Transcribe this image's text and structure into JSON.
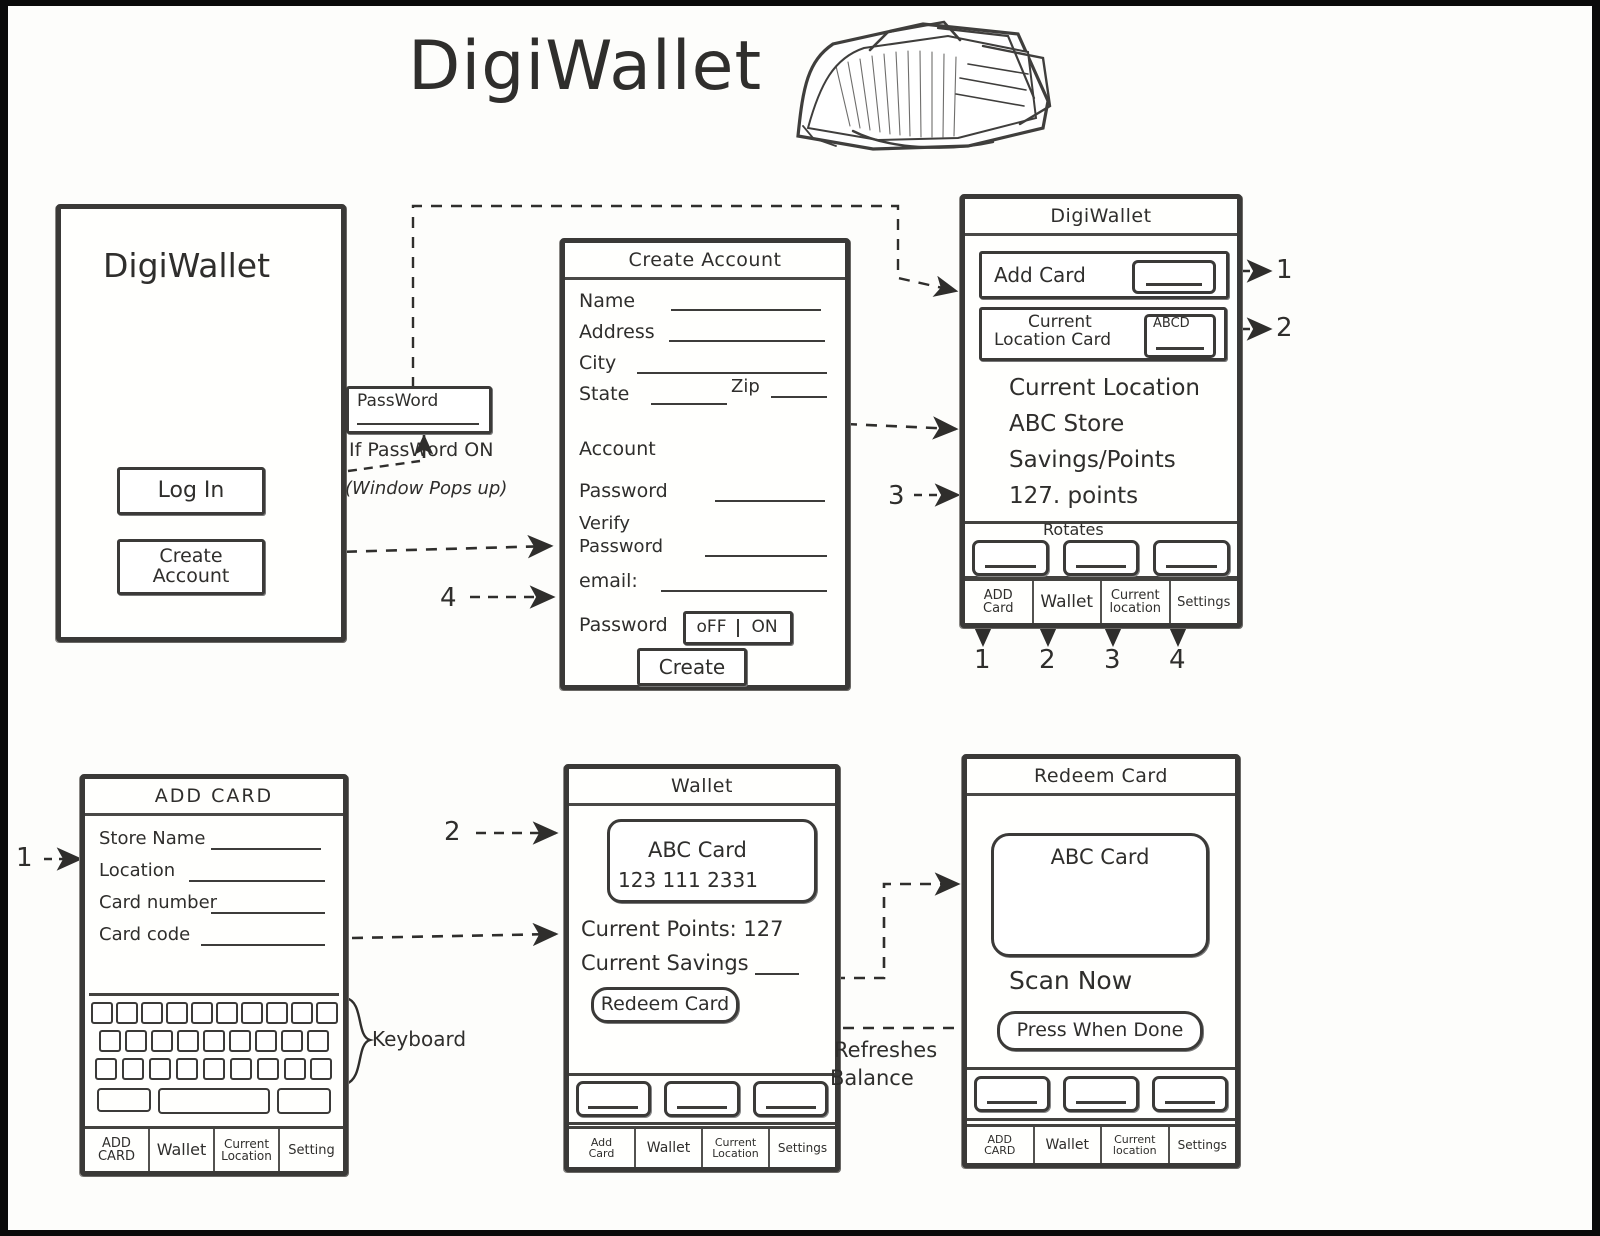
{
  "page": {
    "title": "DigiWallet",
    "icon": "wallet-sketch-icon"
  },
  "screens": {
    "login": {
      "app_title": "DigiWallet",
      "icon": "wallet-sketch-icon",
      "buttons": [
        {
          "label": "Log In",
          "name": "log-in-button"
        },
        {
          "label": "Create\nAccount",
          "line1": "Create",
          "line2": "Account",
          "name": "create-account-button"
        }
      ]
    },
    "password_popup": {
      "field_label": "PassWord",
      "note_line1": "If PassWord ON",
      "note_line2": "(Window Pops up)"
    },
    "create_account": {
      "title": "Create Account",
      "fields": [
        {
          "label": "Name"
        },
        {
          "label": "Address"
        },
        {
          "label": "City"
        },
        {
          "label": "State"
        },
        {
          "label": "Zip"
        },
        {
          "label": "Account"
        },
        {
          "label": "Password"
        },
        {
          "label": "Verify",
          "label2": "Password"
        },
        {
          "label": "email:"
        }
      ],
      "toggle_label": "Password",
      "toggle_off": "oFF",
      "toggle_on": "ON",
      "submit_label": "Create"
    },
    "digiwallet_main": {
      "title": "DigiWallet",
      "add_card_label": "Add Card",
      "current_location_card_line1": "Current",
      "current_location_card_line2": "Location Card",
      "card_badge": "ABCD",
      "info_line1": "Current Location",
      "info_line2": "ABC Store",
      "info_line3": "Savings/Points",
      "info_line4": "127. points",
      "rotates_label": "Rotates",
      "nav": [
        "ADD\nCard",
        "Wallet",
        "Current\nlocation",
        "Settings"
      ],
      "nav_items": [
        {
          "line1": "ADD",
          "line2": "Card"
        },
        {
          "line1": "Wallet",
          "line2": ""
        },
        {
          "line1": "Current",
          "line2": "location"
        },
        {
          "line1": "Settings",
          "line2": ""
        }
      ],
      "nav_numbers": [
        "1",
        "2",
        "3",
        "4"
      ],
      "callouts": {
        "right_1": "1",
        "right_2": "2",
        "left_3": "3"
      }
    },
    "add_card": {
      "title": "ADD  CARD",
      "fields": [
        {
          "label": "Store Name"
        },
        {
          "label": "Location"
        },
        {
          "label": "Card number"
        },
        {
          "label": "Card code"
        }
      ],
      "keyboard_label": "Keyboard",
      "keyboard_rows": [
        10,
        9,
        9
      ],
      "nav_items": [
        {
          "line1": "ADD",
          "line2": "CARD"
        },
        {
          "line1": "Wallet",
          "line2": ""
        },
        {
          "line1": "Current",
          "line2": "Location"
        },
        {
          "line1": "Setting",
          "line2": ""
        }
      ],
      "callout": "1"
    },
    "wallet": {
      "title": "Wallet",
      "card_name": "ABC Card",
      "card_number": "123  111  2331",
      "points_label": "Current Points: 127",
      "savings_label": "Current Savings",
      "redeem_label": "Redeem Card",
      "nav_items": [
        {
          "line1": "Add",
          "line2": "Card"
        },
        {
          "line1": "Wallet",
          "line2": ""
        },
        {
          "line1": "Current",
          "line2": "Location"
        },
        {
          "line1": "Settings",
          "line2": ""
        }
      ],
      "callout": "2"
    },
    "redeem_card": {
      "title": "Redeem Card",
      "card_name": "ABC Card",
      "barcode": "barcode-icon",
      "scan_label": "Scan Now",
      "done_label": "Press When Done",
      "refresh_note_line1": "Refreshes",
      "refresh_note_line2": "Balance",
      "nav_items": [
        {
          "line1": "ADD",
          "line2": "CARD"
        },
        {
          "line1": "Wallet",
          "line2": ""
        },
        {
          "line1": "Current",
          "line2": "location"
        },
        {
          "line1": "Settings",
          "line2": ""
        }
      ]
    }
  },
  "annotations": {
    "flow_4": "4",
    "flow_2": "2",
    "flow_1": "1",
    "flow_3": "3"
  },
  "colors": {
    "ink": "#2f2e2c",
    "paper": "#fdfdfb",
    "frame": "#3a3937",
    "border": "#0a0a0a"
  }
}
